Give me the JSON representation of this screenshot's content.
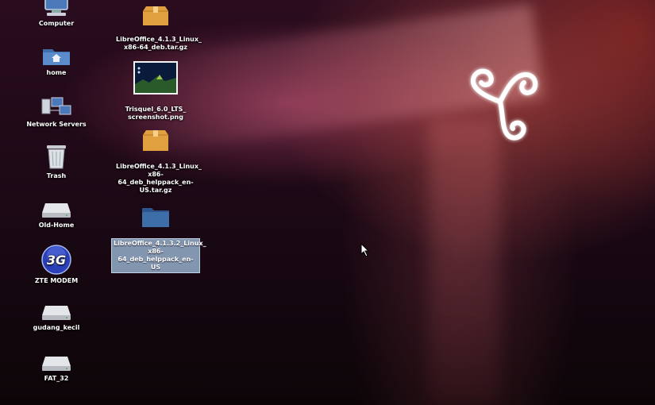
{
  "colors": {
    "wallpaper_dark": "#1a0814",
    "wallpaper_accent": "#c85046",
    "folder_blue": "#3e6ea8",
    "package_orange": "#e0a040",
    "selection": "#96afcd"
  },
  "desktop": {
    "left_column": [
      {
        "label": "Computer",
        "icon": "computer-icon"
      },
      {
        "label": "home",
        "icon": "home-folder-icon"
      },
      {
        "label": "Network Servers",
        "icon": "network-servers-icon"
      },
      {
        "label": "Trash",
        "icon": "trash-icon"
      },
      {
        "label": "Old-Home",
        "icon": "drive-icon"
      },
      {
        "label": "ZTE MODEM",
        "icon": "3g-modem-icon"
      },
      {
        "label": "gudang_kecil",
        "icon": "drive-icon"
      },
      {
        "label": "FAT_32",
        "icon": "drive-icon"
      }
    ],
    "files": [
      {
        "label": "LibreOffice_4.1.3_Linux_\nx86-64_deb.tar.gz",
        "icon": "package-icon",
        "selected": false
      },
      {
        "label": "Trisquel_6.0_LTS_\nscreenshot.png",
        "icon": "image-thumbnail-icon",
        "selected": false
      },
      {
        "label": "LibreOffice_4.1.3_Linux_\nx86-64_deb_helppack_en-\nUS.tar.gz",
        "icon": "package-icon",
        "selected": false
      },
      {
        "label": "LibreOffice_4.1.3.2_Linux_\nx86-64_deb_helppack_en-\nUS",
        "icon": "folder-icon",
        "selected": true
      }
    ]
  }
}
